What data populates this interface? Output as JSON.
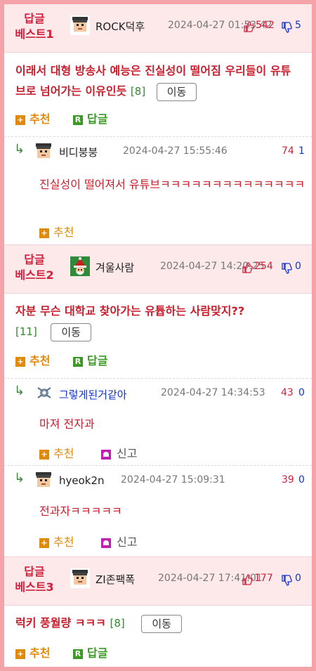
{
  "posts": [
    {
      "best_label_1": "답글",
      "best_label_2": "베스트1",
      "author": "ROCK덕후",
      "date": "2024-04-27 01:53:42",
      "up": "542",
      "down": "5",
      "title": "이래서 대형 방송사 예능은 진실성이 떨어짐 우리들이 유튜브로 넘어가는 이유인듯",
      "count": "[8]",
      "move": "이동",
      "recommend": "추천",
      "reply": "답글",
      "comments": [
        {
          "author": "비디붕붕",
          "date": "2024-04-27 15:55:46",
          "up": "74",
          "down": "1",
          "text": "진실성이 떨어져서 유튜브ㅋㅋㅋㅋㅋㅋㅋㅋㅋㅋㅋㅋㅋㅋ",
          "recommend": "추천"
        }
      ]
    },
    {
      "best_label_1": "답글",
      "best_label_2": "베스트2",
      "author": "겨울사람",
      "date": "2024-04-27 14:20:25",
      "up": "254",
      "down": "0",
      "title": "자분 무슨 대학교 찾아가는 유튭하는 사람맞지??",
      "count": "[11]",
      "move": "이동",
      "recommend": "추천",
      "reply": "답글",
      "comments": [
        {
          "author": "그렇게된거같아",
          "date": "2024-04-27 14:34:53",
          "up": "43",
          "down": "0",
          "text": "마져 전자과",
          "recommend": "추천",
          "report": "신고"
        },
        {
          "author": "hyeok2n",
          "date": "2024-04-27 15:09:31",
          "up": "39",
          "down": "0",
          "text": "전과자ㅋㅋㅋㅋㅋ",
          "recommend": "추천",
          "report": "신고"
        }
      ]
    },
    {
      "best_label_1": "답글",
      "best_label_2": "베스트3",
      "author": "ZI존팩폭",
      "date": "2024-04-27 17:41:01",
      "up": "177",
      "down": "0",
      "title": "럭키 풍월량 ㅋㅋㅋ",
      "count": "[8]",
      "move": "이동",
      "recommend": "추천",
      "reply": "답글"
    }
  ],
  "icons": {
    "recommend": "plus-icon",
    "reply": "reply-r-icon",
    "arrow": "reply-arrow-icon",
    "up": "thumbs-up-icon",
    "down": "thumbs-down-icon",
    "report": "report-icon"
  },
  "colors": {
    "border": "#f5a3a8",
    "header_bg": "#fde8ea",
    "title_red": "#c8202e",
    "down_blue": "#1133cc",
    "orange": "#e08a0c",
    "green": "#3a9a23"
  }
}
